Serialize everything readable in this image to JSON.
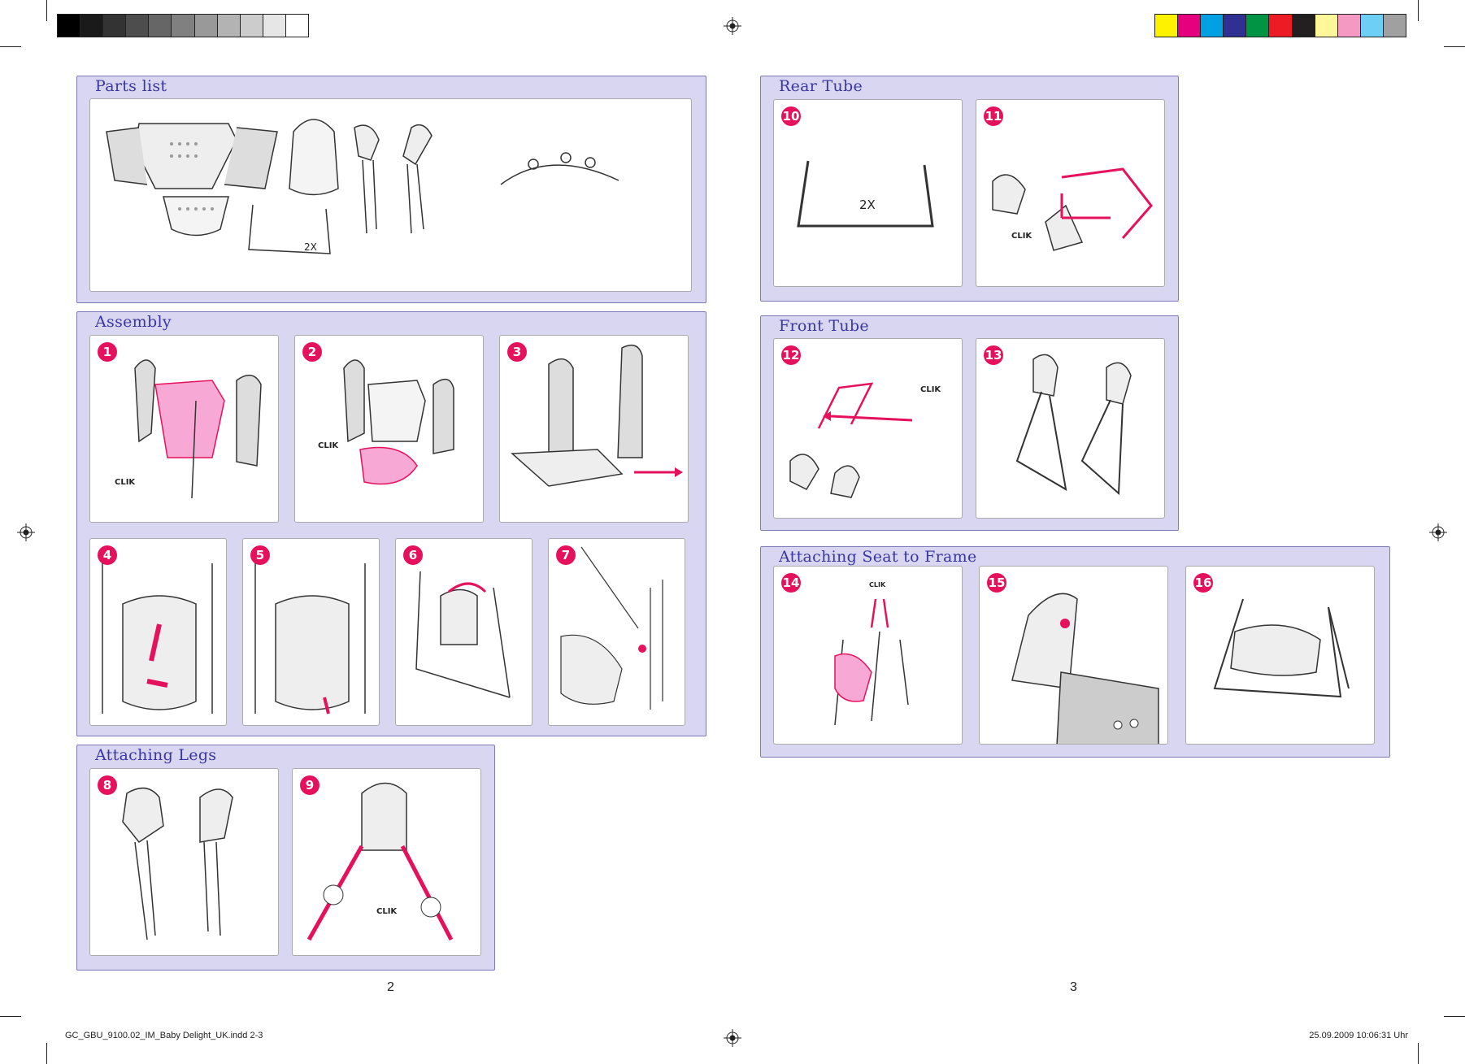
{
  "grayscale_bar": [
    "#000000",
    "#1a1a1a",
    "#333333",
    "#4d4d4d",
    "#666666",
    "#808080",
    "#999999",
    "#b3b3b3",
    "#cccccc",
    "#e6e6e6",
    "#ffffff"
  ],
  "color_bar": [
    "#fff200",
    "#e6007e",
    "#00a0e3",
    "#2e3192",
    "#009444",
    "#ed1c24",
    "#231f20",
    "#fff799",
    "#f49ac2",
    "#6dcff6",
    "#a0a0a0"
  ],
  "accent_color": "#e5115c",
  "panel_color": "#d8d6f0",
  "title_color": "#3a37a0",
  "sections": {
    "parts_list": {
      "title": "Parts list",
      "label_2x": "2X"
    },
    "assembly": {
      "title": "Assembly"
    },
    "attaching_legs": {
      "title": "Attaching Legs"
    },
    "rear_tube": {
      "title": "Rear Tube",
      "label_2x": "2X"
    },
    "front_tube": {
      "title": "Front Tube"
    },
    "attaching_seat": {
      "title": "Attaching Seat to Frame"
    }
  },
  "steps": [
    "1",
    "2",
    "3",
    "4",
    "5",
    "6",
    "7",
    "8",
    "9",
    "10",
    "11",
    "12",
    "13",
    "14",
    "15",
    "16"
  ],
  "clik": "CLIK",
  "page_numbers": {
    "left": "2",
    "right": "3"
  },
  "footer": {
    "file": "GC_GBU_9100.02_IM_Baby Delight_UK.indd   2-3",
    "timestamp": "25.09.2009   10:06:31 Uhr"
  }
}
